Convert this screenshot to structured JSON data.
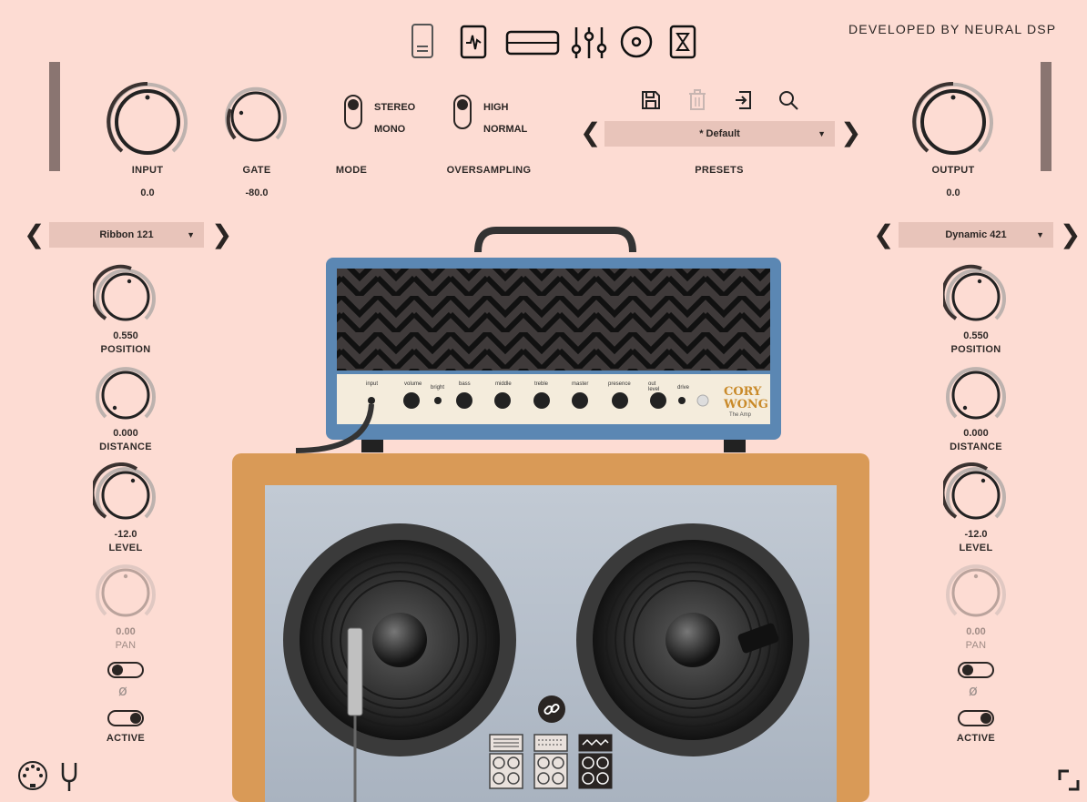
{
  "header": {
    "developer": "DEVELOPED BY NEURAL DSP",
    "icons": [
      "pedal-icon",
      "waveform-icon",
      "amp-head-icon",
      "eq-sliders-icon",
      "reverb-icon",
      "delay-icon"
    ]
  },
  "input": {
    "label": "INPUT",
    "value": "0.0"
  },
  "gate": {
    "label": "GATE",
    "value": "-80.0"
  },
  "mode": {
    "label": "MODE",
    "opt1": "STEREO",
    "opt2": "MONO"
  },
  "oversampling": {
    "label": "OVERSAMPLING",
    "opt1": "HIGH",
    "opt2": "NORMAL"
  },
  "presets": {
    "label": "PRESETS",
    "current": "* Default"
  },
  "output": {
    "label": "OUTPUT",
    "value": "0.0"
  },
  "mic_left": {
    "model": "Ribbon 121",
    "position": {
      "value": "0.550",
      "label": "POSITION"
    },
    "distance": {
      "value": "0.000",
      "label": "DISTANCE"
    },
    "level": {
      "value": "-12.0",
      "label": "LEVEL"
    },
    "pan": {
      "value": "0.00",
      "label": "PAN"
    },
    "phase": "ø",
    "active": "ACTIVE"
  },
  "mic_right": {
    "model": "Dynamic 421",
    "position": {
      "value": "0.550",
      "label": "POSITION"
    },
    "distance": {
      "value": "0.000",
      "label": "DISTANCE"
    },
    "level": {
      "value": "-12.0",
      "label": "LEVEL"
    },
    "pan": {
      "value": "0.00",
      "label": "PAN"
    },
    "phase": "ø",
    "active": "ACTIVE"
  },
  "amp": {
    "controls": [
      "input",
      "volume",
      "bright",
      "bass",
      "middle",
      "treble",
      "master",
      "presence",
      "out level",
      "drive"
    ],
    "brand_line1": "CORY",
    "brand_line2": "WONG",
    "brand_sub": "The Amp"
  },
  "colors": {
    "background": "#fddcd3",
    "dropdown": "#e8c4ba",
    "amp_tolex": "#5b87b3",
    "cab_wood": "#d99a57"
  }
}
